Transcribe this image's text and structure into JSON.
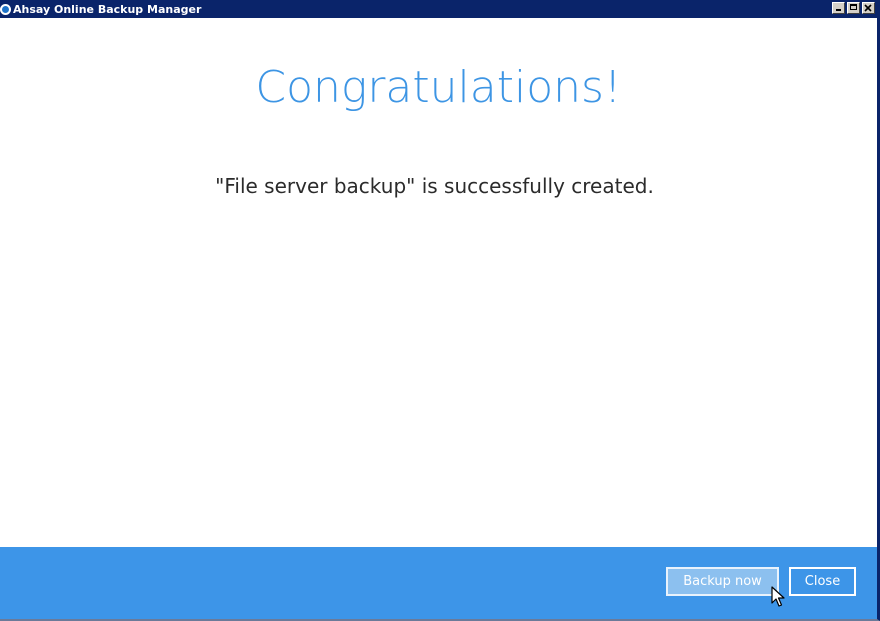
{
  "window": {
    "title": "Ahsay Online Backup Manager"
  },
  "main": {
    "headline": "Congratulations!",
    "message": "\"File server backup\" is successfully created."
  },
  "footer": {
    "backup_now_label": "Backup now",
    "close_label": "Close"
  },
  "colors": {
    "accent": "#3d95e8",
    "titlebar": "#0a246a"
  }
}
